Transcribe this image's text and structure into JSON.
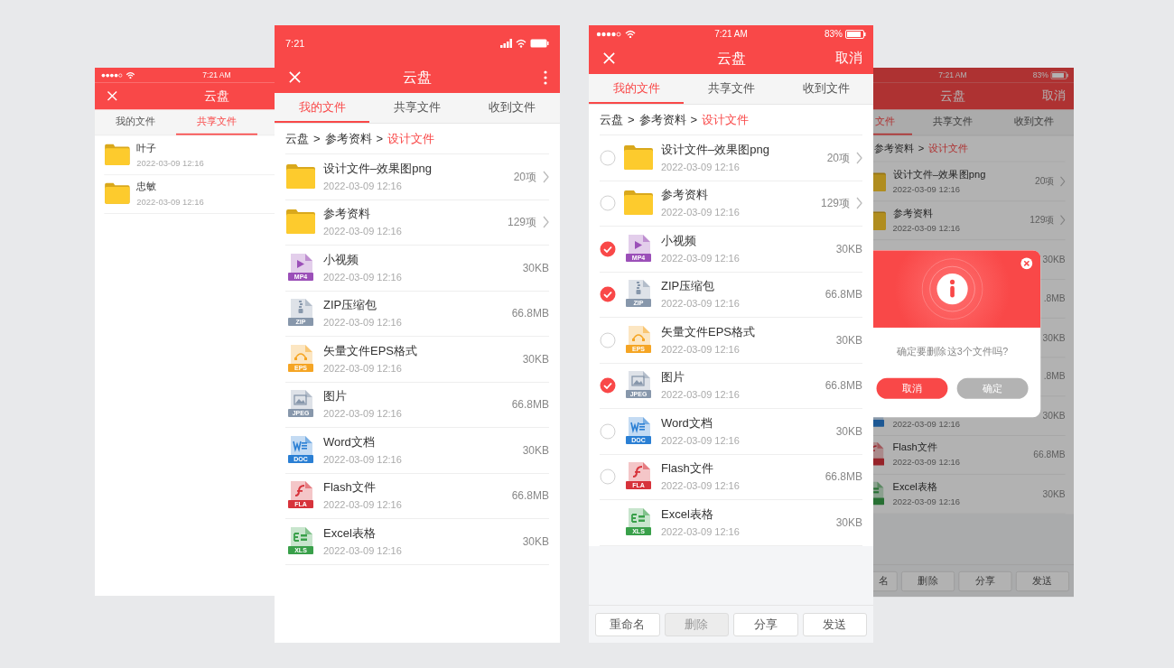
{
  "phones": [
    {
      "status": {
        "kind": "ios",
        "time": "7:21 AM"
      },
      "header": {
        "close": true,
        "title": "云盘"
      },
      "select_mode": false,
      "tabs": [
        {
          "label": "我的文件",
          "selected": false
        },
        {
          "label": "共享文件",
          "selected": true
        }
      ],
      "rows": [
        {
          "kind": "folder",
          "name": "叶子",
          "date": "2022-03-09 12:16"
        },
        {
          "kind": "folder",
          "name": "忠敏",
          "date": "2022-03-09 12:16"
        }
      ]
    },
    {
      "status": {
        "kind": "android",
        "time": "7:21"
      },
      "header": {
        "close": true,
        "title": "云盘",
        "action": {
          "kind": "more"
        }
      },
      "select_mode": false,
      "tabs": [
        {
          "label": "我的文件",
          "selected": true
        },
        {
          "label": "共享文件",
          "selected": false
        },
        {
          "label": "收到文件",
          "selected": false
        }
      ],
      "breadcrumb": [
        {
          "kind": "link",
          "text": "云盘"
        },
        {
          "kind": "separator",
          "text": ">"
        },
        {
          "kind": "link",
          "text": "参考资料"
        },
        {
          "kind": "separator",
          "text": ">"
        },
        {
          "kind": "current",
          "text": "设计文件"
        }
      ],
      "rows": [
        {
          "kind": "folder",
          "name": "设计文件–效果图png",
          "date": "2022-03-09 12:16",
          "size": "20项"
        },
        {
          "kind": "folder",
          "name": "参考资料",
          "date": "2022-03-09 12:16",
          "size": "129项"
        },
        {
          "kind": "video",
          "badge": "MP4",
          "name": "小视频",
          "date": "2022-03-09 12:16",
          "size": "30KB"
        },
        {
          "kind": "archive",
          "badge": "ZIP",
          "name": "ZIP压缩包",
          "date": "2022-03-09 12:16",
          "size": "66.8MB"
        },
        {
          "kind": "vector",
          "badge": "EPS",
          "name": "矢量文件EPS格式",
          "date": "2022-03-09 12:16",
          "size": "30KB"
        },
        {
          "kind": "image",
          "badge": "JPEG",
          "name": "图片",
          "date": "2022-03-09 12:16",
          "size": "66.8MB"
        },
        {
          "kind": "word",
          "badge": "DOC",
          "name": "Word文档",
          "date": "2022-03-09 12:16",
          "size": "30KB"
        },
        {
          "kind": "flash",
          "badge": "FLA",
          "name": "Flash文件",
          "date": "2022-03-09 12:16",
          "size": "66.8MB"
        },
        {
          "kind": "sheet",
          "badge": "XLS",
          "name": "Excel表格",
          "date": "2022-03-09 12:16",
          "size": "30KB"
        }
      ]
    },
    {
      "status": {
        "kind": "ios",
        "time": "7:21 AM",
        "battery": "83%"
      },
      "header": {
        "close": true,
        "title": "云盘",
        "action": {
          "kind": "text",
          "label": "取消"
        }
      },
      "select_mode": true,
      "tabs": [
        {
          "label": "我的文件",
          "selected": true
        },
        {
          "label": "共享文件",
          "selected": false
        },
        {
          "label": "收到文件",
          "selected": false
        }
      ],
      "breadcrumb": [
        {
          "kind": "link",
          "text": "云盘"
        },
        {
          "kind": "separator",
          "text": ">"
        },
        {
          "kind": "link",
          "text": "参考资料"
        },
        {
          "kind": "separator",
          "text": ">"
        },
        {
          "kind": "current",
          "text": "设计文件"
        }
      ],
      "rows": [
        {
          "kind": "folder",
          "checked": false,
          "name": "设计文件–效果图png",
          "date": "2022-03-09 12:16",
          "size": "20项"
        },
        {
          "kind": "folder",
          "checked": false,
          "name": "参考资料",
          "date": "2022-03-09 12:16",
          "size": "129项"
        },
        {
          "kind": "video",
          "checked": true,
          "badge": "MP4",
          "name": "小视频",
          "date": "2022-03-09 12:16",
          "size": "30KB"
        },
        {
          "kind": "archive",
          "checked": true,
          "badge": "ZIP",
          "name": "ZIP压缩包",
          "date": "2022-03-09 12:16",
          "size": "66.8MB"
        },
        {
          "kind": "vector",
          "checked": false,
          "badge": "EPS",
          "name": "矢量文件EPS格式",
          "date": "2022-03-09 12:16",
          "size": "30KB"
        },
        {
          "kind": "image",
          "checked": true,
          "badge": "JPEG",
          "name": "图片",
          "date": "2022-03-09 12:16",
          "size": "66.8MB"
        },
        {
          "kind": "word",
          "checked": false,
          "badge": "DOC",
          "name": "Word文档",
          "date": "2022-03-09 12:16",
          "size": "30KB"
        },
        {
          "kind": "flash",
          "checked": false,
          "badge": "FLA",
          "name": "Flash文件",
          "date": "2022-03-09 12:16",
          "size": "66.8MB"
        },
        {
          "kind": "sheet",
          "badge": "XLS",
          "name": "Excel表格",
          "date": "2022-03-09 12:16",
          "size": "30KB"
        }
      ],
      "bottom_bar": [
        {
          "label": "重命名",
          "pressed": false
        },
        {
          "label": "删除",
          "pressed": true
        },
        {
          "label": "分享",
          "pressed": false
        },
        {
          "label": "发送",
          "pressed": false
        }
      ]
    },
    {
      "status": {
        "kind": "ios",
        "time": "7:21 AM",
        "battery": "83%"
      },
      "header": {
        "close": false,
        "title": "云盘",
        "action": {
          "kind": "text",
          "label": "取消"
        }
      },
      "select_mode": true,
      "tabs": [
        {
          "label": "文件",
          "selected": true
        },
        {
          "label": "共享文件",
          "selected": false
        },
        {
          "label": "收到文件",
          "selected": false
        }
      ],
      "breadcrumb": [
        {
          "kind": "link",
          "text": "参考资料"
        },
        {
          "kind": "separator",
          "text": ">"
        },
        {
          "kind": "current",
          "text": "设计文件"
        }
      ],
      "rows": [
        {
          "kind": "folder",
          "name": "设计文件–效果图png",
          "date": "2022-03-09 12:16",
          "size": "20项"
        },
        {
          "kind": "folder",
          "name": "参考资料",
          "date": "2022-03-09 12:16",
          "size": "129项"
        },
        {
          "kind": "file",
          "size": "30KB"
        },
        {
          "kind": "file",
          "size": ".8MB"
        },
        {
          "kind": "file",
          "size": "30KB"
        },
        {
          "kind": "file",
          "size": ".8MB"
        },
        {
          "kind": "word",
          "date": "2022-03-09 12:16",
          "size": "30KB"
        },
        {
          "kind": "flash",
          "name": "Flash文件",
          "date": "2022-03-09 12:16",
          "size": "66.8MB"
        },
        {
          "kind": "sheet",
          "name": "Excel表格",
          "date": "2022-03-09 12:16",
          "size": "30KB"
        }
      ],
      "bottom_bar": [
        {
          "label": "名",
          "pressed": false
        },
        {
          "label": "删除",
          "pressed": false
        },
        {
          "label": "分享",
          "pressed": false
        },
        {
          "label": "发送",
          "pressed": false
        }
      ],
      "dialog": {
        "message": "确定要删除这3个文件吗?",
        "buttons": [
          {
            "label": "取消",
            "primary": true
          },
          {
            "label": "确定",
            "primary": false
          }
        ]
      }
    }
  ]
}
